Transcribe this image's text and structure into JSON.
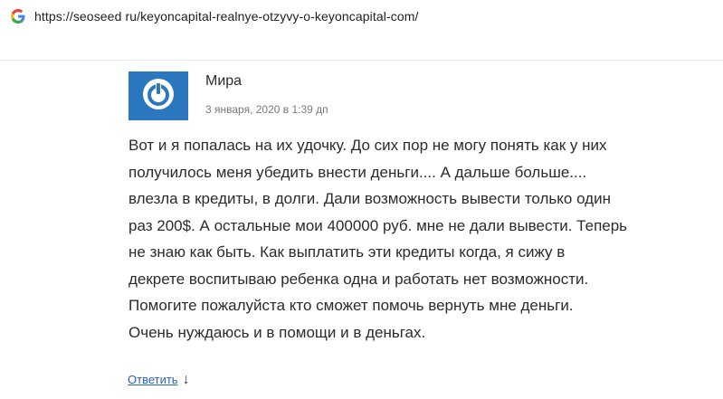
{
  "browser": {
    "url": "https://seoseed ru/keyoncapital-realnye-otzyvy-o-keyoncapital-com/",
    "site_icon": "google-g-icon"
  },
  "comment": {
    "author": "Мира",
    "date": "3 января, 2020 в 1:39 дп",
    "avatar_icon": "power-avatar-icon",
    "lines": [
      "Вот и я попалась на их удочку. До сих пор не могу понять как у них",
      "получилось меня убедить внести деньги.... А дальше больше....",
      "влезла в кредиты, в долги. Дали возможность вывести только один",
      "раз 200$. А остальные мои 400000 руб. мне не дали вывести. Теперь",
      "не знаю как быть. Как выплатить эти кредиты когда, я сижу в",
      "декрете воспитываю ребенка одна и работать нет возможности.",
      "Помогите пожалуйста кто сможет помочь вернуть мне деньги.",
      "Очень нуждаюсь и в помощи и в деньгах."
    ],
    "reply_label": "Ответить",
    "reply_arrow": "↓"
  },
  "colors": {
    "avatar_bg": "#2c78c0",
    "link": "#2a63b8"
  }
}
